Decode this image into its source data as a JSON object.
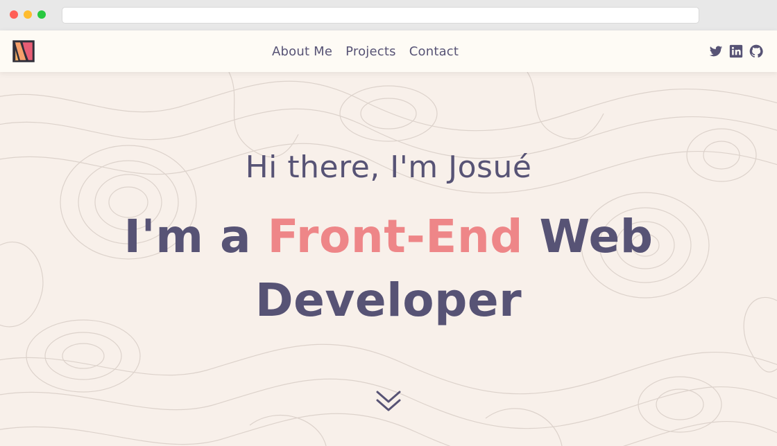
{
  "browser": {
    "address_value": ""
  },
  "header": {
    "logo_icon": "m-logo-icon",
    "nav": [
      {
        "label": "About Me"
      },
      {
        "label": "Projects"
      },
      {
        "label": "Contact"
      }
    ],
    "social_icons": [
      "twitter-icon",
      "linkedin-icon",
      "github-icon"
    ]
  },
  "hero": {
    "greeting": "Hi there, I'm Josué",
    "headline_prefix": "I'm a",
    "headline_accent": "Front-End",
    "headline_suffix": "Web Developer",
    "scroll_icon": "double-chevron-down-icon"
  },
  "colors": {
    "primary": "#575375",
    "accent": "#ee8688",
    "background": "#f8f0ea",
    "header_background": "#fefbf5"
  }
}
